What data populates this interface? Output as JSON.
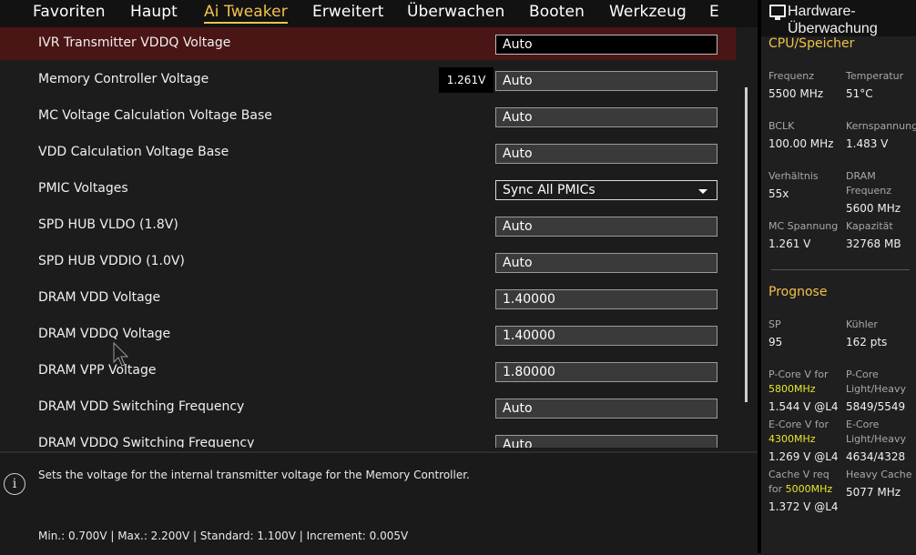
{
  "nav": {
    "tabs": [
      "Favoriten",
      "Haupt",
      "Ai Tweaker",
      "Erweitert",
      "Überwachen",
      "Booten",
      "Werkzeug",
      "E"
    ],
    "active_tab": "Ai Tweaker"
  },
  "settings": {
    "rows": [
      {
        "label": "IVR Transmitter VDDQ Voltage",
        "value": "Auto"
      },
      {
        "label": "Memory Controller Voltage",
        "value": "Auto",
        "tooltip": "1.261V"
      },
      {
        "label": "MC Voltage Calculation Voltage Base",
        "value": "Auto"
      },
      {
        "label": "VDD Calculation Voltage Base",
        "value": "Auto"
      },
      {
        "label": "PMIC Voltages",
        "value": "Sync All PMICs"
      },
      {
        "label": "SPD HUB VLDO (1.8V)",
        "value": "Auto"
      },
      {
        "label": "SPD HUB VDDIO (1.0V)",
        "value": "Auto"
      },
      {
        "label": "DRAM VDD Voltage",
        "value": "1.40000"
      },
      {
        "label": "DRAM VDDQ Voltage",
        "value": "1.40000"
      },
      {
        "label": "DRAM VPP Voltage",
        "value": "1.80000"
      },
      {
        "label": "DRAM VDD Switching Frequency",
        "value": "Auto"
      },
      {
        "label": "DRAM VDDQ Switching Frequency",
        "value": "Auto"
      }
    ]
  },
  "help": {
    "description": "Sets the voltage for the internal transmitter voltage for the Memory Controller.",
    "range": "Min.: 0.700V   |   Max.: 2.200V   |   Standard: 1.100V   |   Increment: 0.005V"
  },
  "hw": {
    "title": "Hardware-Überwachung",
    "cpu_section": "CPU/Speicher",
    "freq_label": "Frequenz",
    "freq_value": "5500 MHz",
    "temp_label": "Temperatur",
    "temp_value": "51°C",
    "bclk_label": "BCLK",
    "bclk_value": "100.00 MHz",
    "core_v_label": "Kernspannung",
    "core_v_value": "1.483 V",
    "ratio_label": "Verhältnis",
    "ratio_value": "55x",
    "dram_freq_label": "DRAM Frequenz",
    "dram_freq_value": "5600 MHz",
    "mc_v_label": "MC Spannung",
    "mc_v_value": "1.261 V",
    "capacity_label": "Kapazität",
    "capacity_value": "32768 MB",
    "prognose_section": "Prognose",
    "sp_label": "SP",
    "sp_value": "95",
    "cooler_label": "Kühler",
    "cooler_value": "162 pts",
    "pcore_label": "P-Core V for",
    "pcore_freq": "5800MHz",
    "pcore_value": "1.544 V @L4",
    "pcore_lh_label": "P-Core Light/Heavy",
    "pcore_lh_value": "5849/5549",
    "ecore_label": "E-Core V for",
    "ecore_freq": "4300MHz",
    "ecore_value": "1.269 V @L4",
    "ecore_lh_label": "E-Core Light/Heavy",
    "ecore_lh_value": "4634/4328",
    "cache_label": "Cache V req for",
    "cache_freq": "5000MHz",
    "cache_value": "1.372 V @L4",
    "heavy_cache_label": "Heavy Cache",
    "heavy_cache_value": "5077 MHz"
  },
  "colors": {
    "accent": "#f1c24a",
    "selected_row": "#4a1515",
    "highlight": "#e8e82a"
  }
}
